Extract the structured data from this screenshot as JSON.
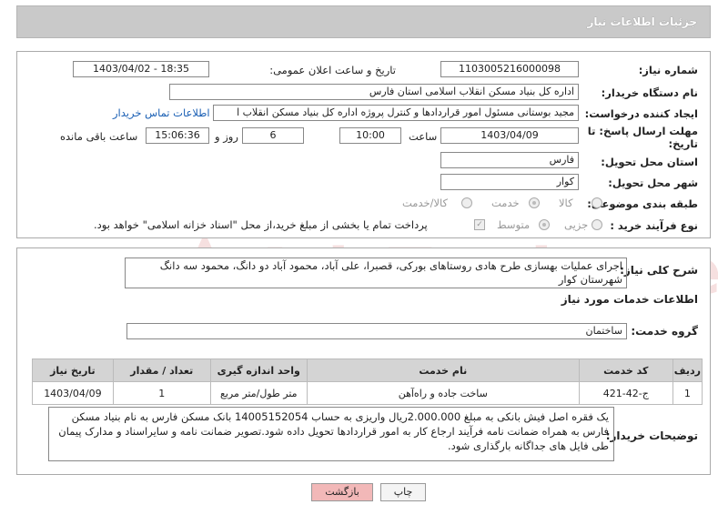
{
  "header": {
    "title": "جزئیات اطلاعات نیاز"
  },
  "watermark": {
    "text": "AriaTender.neT"
  },
  "form": {
    "need_number_label": "شماره نیاز:",
    "need_number": "1103005216000098",
    "announce_label": "تاریخ و ساعت اعلان عمومی:",
    "announce_value": "1403/04/02 - 18:35",
    "buyer_org_label": "نام دستگاه خریدار:",
    "buyer_org": "اداره کل بنیاد مسکن انقلاب اسلامی استان فارس",
    "creator_label": "ایجاد کننده درخواست:",
    "creator": "مجید بوستانی مسئول امور قراردادها و کنترل پروژه اداره کل بنیاد مسکن انقلاب ا",
    "contact_link": "اطلاعات تماس خریدار",
    "deadline_label_1": "مهلت ارسال پاسخ: تا",
    "deadline_label_2": "تاریخ:",
    "deadline_date": "1403/04/09",
    "time_label": "ساعت",
    "deadline_time": "10:00",
    "days_value": "6",
    "days_label": "روز و",
    "remaining_time": "15:06:36",
    "remaining_label": "ساعت باقی مانده",
    "province_label": "استان محل تحویل:",
    "province": "فارس",
    "city_label": "شهر محل تحویل:",
    "city": "کوار",
    "category_label": "طبقه بندی موضوعی:",
    "category_options": [
      "کالا",
      "خدمت",
      "کالا/خدمت"
    ],
    "purchase_type_label": "نوع فرآیند خرید :",
    "purchase_type_options": [
      "جزیی",
      "متوسط"
    ],
    "payment_note": "پرداخت تمام یا بخشی از مبلغ خرید،از محل \"اسناد خزانه اسلامی\" خواهد بود."
  },
  "summary": {
    "label": "شرح کلی نیاز:",
    "text": "اجرای عملیات بهسازی طرح هادی روستاهای بورکی، قصبرا، علی آباد، محمود آباد دو دانگ، محمود سه دانگ شهرستان کوار"
  },
  "services": {
    "section_title": "اطلاعات خدمات مورد نیاز",
    "group_label": "گروه خدمت:",
    "group_value": "ساختمان",
    "table": {
      "headers": [
        "ردیف",
        "کد خدمت",
        "نام خدمت",
        "واحد اندازه گیری",
        "تعداد / مقدار",
        "تاریخ نیاز"
      ],
      "rows": [
        [
          "1",
          "ج-42-421",
          "ساخت جاده و راه‌آهن",
          "متر طول/متر مربع",
          "1",
          "1403/04/09"
        ]
      ]
    }
  },
  "buyer_notes": {
    "label": "توضیحات خریدار:",
    "text": "یک فقره اصل فیش بانکی به مبلغ 2.000.000ریال واریزی به حساب 14005152054 بانک مسکن فارس به نام بنیاد مسکن فارس به همراه ضمانت نامه فرآیند ارجاع کار به امور قراردادها تحویل داده شود.تصویر ضمانت نامه و سایراسناد و مدارک پیمان طی فایل های جداگانه بارگذاری شود."
  },
  "buttons": {
    "print": "چاپ",
    "back": "بازگشت"
  },
  "colors": {
    "header_bg": "#c9c9c9",
    "link": "#1a5fb4",
    "back_button_bg": "#f2b8b8",
    "watermark": "#e8a8a8"
  }
}
